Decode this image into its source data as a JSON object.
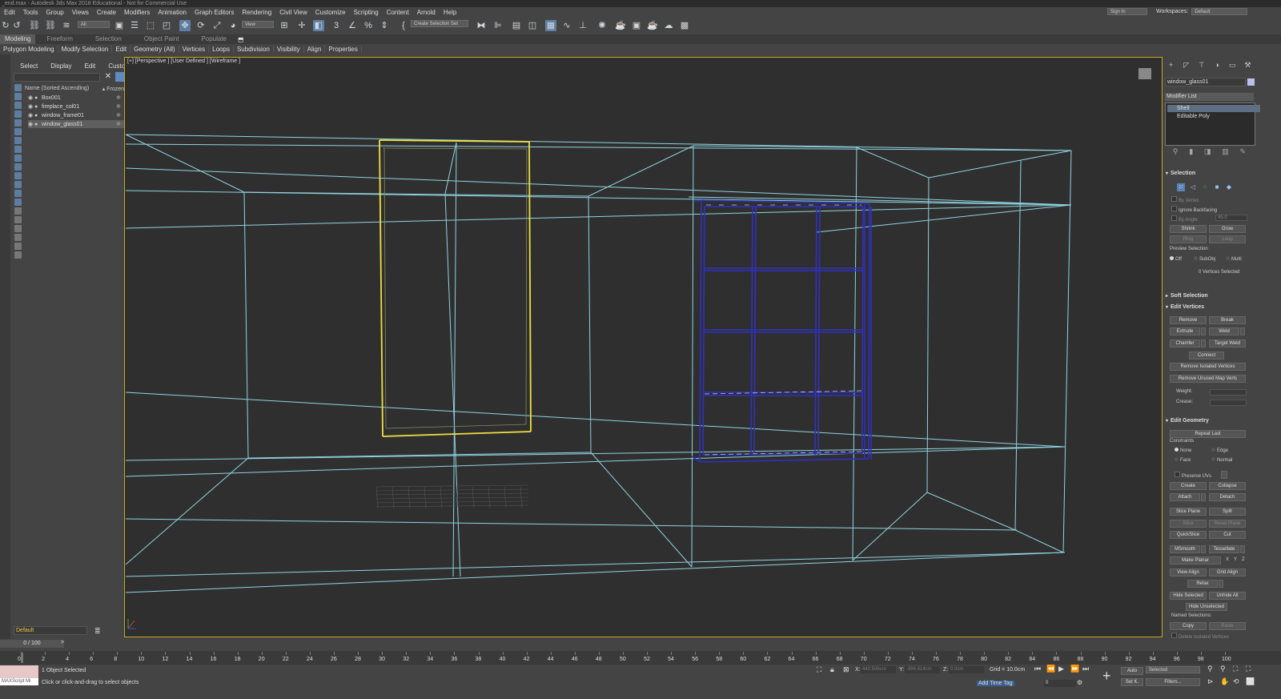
{
  "window": {
    "title": "_end.max - Autodesk 3ds Max 2018 Educational - Not for Commercial Use"
  },
  "menu": {
    "items": [
      "Edit",
      "Tools",
      "Group",
      "Views",
      "Create",
      "Modifiers",
      "Animation",
      "Graph Editors",
      "Rendering",
      "Civil View",
      "Customize",
      "Scripting",
      "Content",
      "Arnold",
      "Help"
    ],
    "signin": "Sign In",
    "workspaces_label": "Workspaces:",
    "workspace": "Default"
  },
  "toolbar": {
    "filter": "All",
    "ref_coord": "View",
    "selection_set": "Create Selection Set"
  },
  "ribbon": {
    "tabs": [
      "Modeling",
      "Freeform",
      "Selection",
      "Object Paint",
      "Populate"
    ],
    "active_tab": "Modeling",
    "subtabs": [
      "Polygon Modeling",
      "Modify Selection",
      "Edit",
      "Geometry (All)",
      "Vertices",
      "Loops",
      "Subdivision",
      "Visibility",
      "Align",
      "Properties"
    ]
  },
  "explorer": {
    "tabs": [
      "Select",
      "Display",
      "Edit",
      "Customize"
    ],
    "column_name": "Name (Sorted Ascending)",
    "column_frozen": "▴ Frozen",
    "objects": [
      {
        "name": "Box001",
        "selected": false
      },
      {
        "name": "fireplace_col01",
        "selected": false
      },
      {
        "name": "window_frame01",
        "selected": false
      },
      {
        "name": "window_glass01",
        "selected": true
      }
    ]
  },
  "viewport": {
    "label": "[+] [Perspective ] [User Defined ] [Wireframe ]",
    "colors": {
      "room": "#8fd3e0",
      "selected": "#f0e040",
      "window": "#3030c0",
      "border": "#c9a520"
    }
  },
  "command_panel": {
    "object_name": "window_glass01",
    "object_color": "#b9c0f0",
    "modifier_list": "Modifier List",
    "stack": [
      {
        "label": "Shell",
        "selected": true
      },
      {
        "label": "Editable Poly",
        "selected": false
      }
    ],
    "selection": {
      "title": "Selection",
      "by_vertex": "By Vertex",
      "ignore_backfacing": "Ignore Backfacing",
      "by_angle": "By Angle:",
      "by_angle_value": "45.0",
      "shrink": "Shrink",
      "grow": "Grow",
      "ring": "Ring",
      "loop": "Loop",
      "preview_label": "Preview Selection",
      "preview_off": "Off",
      "preview_subobj": "SubObj",
      "preview_multi": "Multi",
      "status": "0 Vertices Selected"
    },
    "soft_selection": {
      "title": "Soft Selection"
    },
    "edit_vertices": {
      "title": "Edit Vertices",
      "remove": "Remove",
      "break": "Break",
      "extrude": "Extrude",
      "weld": "Weld",
      "chamfer": "Chamfer",
      "target_weld": "Target Weld",
      "connect": "Connect",
      "remove_isolated": "Remove Isolated Vertices",
      "remove_unused": "Remove Unused Map Verts",
      "weight": "Weight:",
      "crease": "Crease:"
    },
    "edit_geometry": {
      "title": "Edit Geometry",
      "repeat_last": "Repeat Last",
      "constraints": "Constraints",
      "none": "None",
      "edge": "Edge",
      "face": "Face",
      "normal": "Normal",
      "preserve_uvs": "Preserve UVs",
      "create": "Create",
      "collapse": "Collapse",
      "attach": "Attach",
      "detach": "Detach",
      "slice_plane": "Slice Plane",
      "split": "Split",
      "slice": "Slice",
      "reset_plane": "Reset Plane",
      "quickslice": "QuickSlice",
      "cut": "Cut",
      "msmooth": "MSmooth",
      "tessellate": "Tessellate",
      "make_planar": "Make Planar",
      "x": "X",
      "y": "Y",
      "z": "Z",
      "view_align": "View Align",
      "grid_align": "Grid Align",
      "relax": "Relax",
      "hide_selected": "Hide Selected",
      "unhide_all": "Unhide All",
      "hide_unselected": "Hide Unselected",
      "named_selections": "Named Selections:",
      "copy": "Copy",
      "paste": "Paste",
      "delete_isolated": "Delete Isolated Vertices"
    }
  },
  "layer": {
    "name": "Default"
  },
  "timeline": {
    "frame_display": "0 / 100",
    "ticks": [
      "0",
      "2",
      "4",
      "6",
      "8",
      "10",
      "12",
      "14",
      "16",
      "18",
      "20",
      "22",
      "24",
      "26",
      "28",
      "30",
      "32",
      "34",
      "36",
      "38",
      "40",
      "42",
      "44",
      "46",
      "48",
      "50",
      "52",
      "54",
      "56",
      "58",
      "60",
      "62",
      "64",
      "66",
      "68",
      "70",
      "72",
      "74",
      "76",
      "78",
      "80",
      "82",
      "84",
      "86",
      "88",
      "90",
      "92",
      "94",
      "96",
      "98",
      "100"
    ]
  },
  "status": {
    "script": "MAXScript Mi",
    "objects_selected": "1 Object Selected",
    "prompt": "Click or click-and-drag to select objects",
    "x_label": "X:",
    "x_value": "442.506cm",
    "y_label": "Y:",
    "y_value": "-394.814cm",
    "z_label": "Z:",
    "z_value": "0.0cm",
    "grid": "Grid = 10.0cm",
    "add_time_tag": "Add Time Tag",
    "auto": "Auto",
    "selected": "Selected",
    "set_key": "Set K.",
    "filters": "Filters...",
    "frame": "0"
  }
}
